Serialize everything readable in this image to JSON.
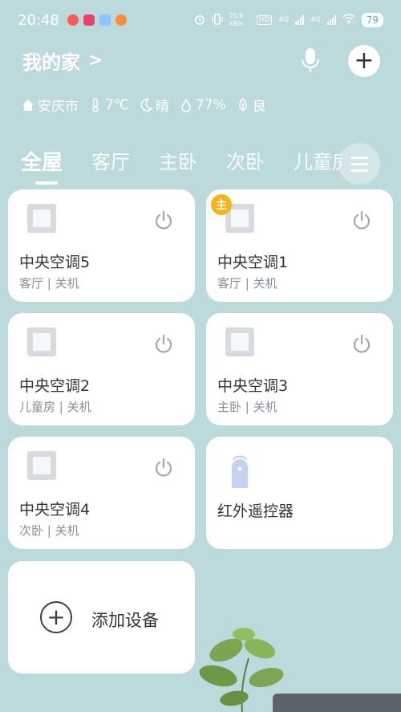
{
  "status_bar": {
    "time": "20:48",
    "net_speed": "35.6 KB/s",
    "hd": "HD",
    "network_1": "4G",
    "network_2": "4G",
    "battery": "79"
  },
  "header": {
    "home_title": "我的家",
    "chevron": ">",
    "add_symbol": "+"
  },
  "weather": {
    "city": "安庆市",
    "temperature": "7℃",
    "condition": "晴",
    "humidity": "77%",
    "air_quality": "良"
  },
  "tabs": [
    {
      "label": "全屋",
      "active": true
    },
    {
      "label": "客厅",
      "active": false
    },
    {
      "label": "主卧",
      "active": false
    },
    {
      "label": "次卧",
      "active": false
    },
    {
      "label": "儿童房",
      "active": false
    }
  ],
  "devices": [
    {
      "name": "中央空调5",
      "sub": "客厅 | 关机"
    },
    {
      "name": "中央空调1",
      "sub": "客厅 | 关机",
      "badge": "主"
    },
    {
      "name": "中央空调2",
      "sub": "儿童房 | 关机"
    },
    {
      "name": "中央空调3",
      "sub": "主卧 | 关机"
    },
    {
      "name": "中央空调4",
      "sub": "次卧 | 关机"
    },
    {
      "name": "红外遥控器"
    }
  ],
  "add_device": {
    "symbol": "+",
    "label": "添加设备"
  },
  "colors": {
    "background": "#bcd9dc",
    "card": "#ffffff",
    "badge": "#f5b41a",
    "remote": "#c6d0f0"
  }
}
